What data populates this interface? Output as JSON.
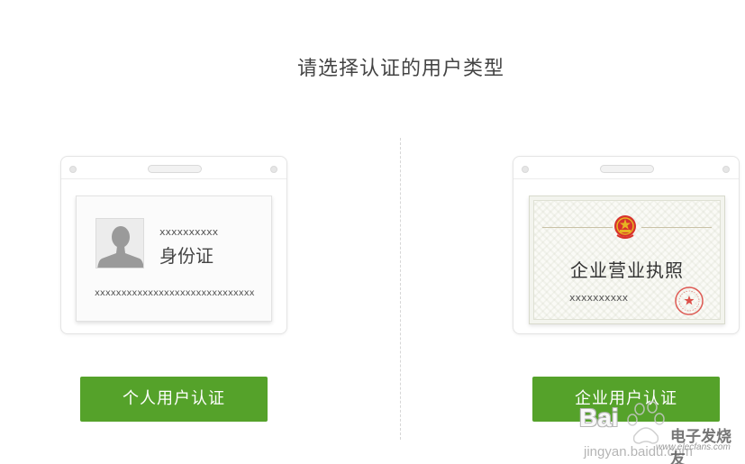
{
  "page": {
    "title": "请选择认证的用户类型"
  },
  "personal": {
    "card_line1": "xxxxxxxxxx",
    "card_title": "身份证",
    "card_line2": "xxxxxxxxxxxxxxxxxxxxxxxxxxxxxx",
    "button_label": "个人用户认证"
  },
  "enterprise": {
    "license_title": "企业营业执照",
    "license_line": "xxxxxxxxxx",
    "button_label": "企业用户认证"
  },
  "watermark": {
    "brand": "Bai",
    "url": "jingyan.baidu.com",
    "site_name": "电子发烧友",
    "site_url": "www.elecfans.com"
  },
  "colors": {
    "button": "#55a22a",
    "divider": "#d6d6d6",
    "seal": "#d8322c"
  },
  "icons": [
    "avatar-silhouette-icon",
    "national-emblem-icon",
    "official-seal-icon",
    "baidu-paw-icon"
  ]
}
